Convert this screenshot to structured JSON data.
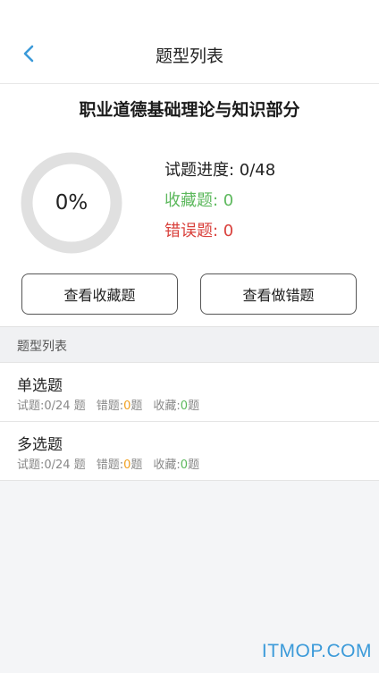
{
  "header": {
    "title": "题型列表",
    "back_icon": "chevron-left-icon"
  },
  "summary": {
    "title": "职业道德基础理论与知识部分",
    "progress_percent": 0,
    "progress_label": "0%",
    "stats": {
      "progress": "试题进度: 0/48",
      "favorites": "收藏题: 0",
      "wrong": "错误题: 0"
    },
    "buttons": {
      "view_favorites": "查看收藏题",
      "view_wrong": "查看做错题"
    }
  },
  "section": {
    "title": "题型列表"
  },
  "list": [
    {
      "title": "单选题",
      "questions_label": "试题:0/24 题",
      "wrong_label": "错题:",
      "wrong_count": "0",
      "wrong_unit": "题",
      "fav_label": "收藏:",
      "fav_count": "0",
      "fav_unit": "题"
    },
    {
      "title": "多选题",
      "questions_label": "试题:0/24 题",
      "wrong_label": "错题:",
      "wrong_count": "0",
      "wrong_unit": "题",
      "fav_label": "收藏:",
      "fav_count": "0",
      "fav_unit": "题"
    }
  ],
  "watermark": "ITMOP.COM",
  "colors": {
    "accent": "#3b9ad9",
    "favorite": "#5cb85c",
    "wrong": "#d9413c",
    "wrong_count": "#f0a020",
    "ring_track": "#e0e0e0"
  }
}
